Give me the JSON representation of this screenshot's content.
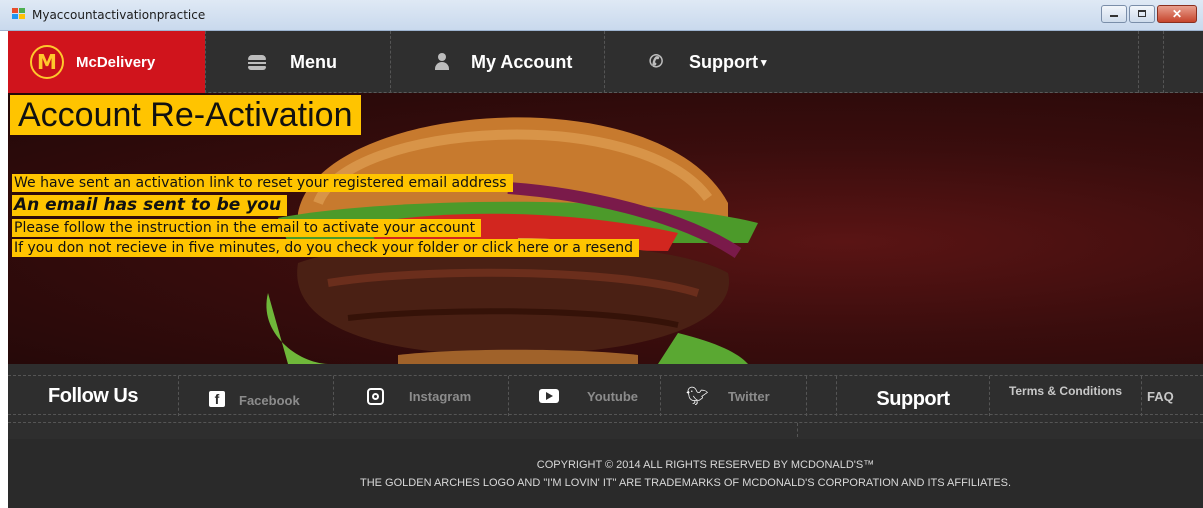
{
  "window": {
    "title": "Myaccountactivationpractice"
  },
  "nav": {
    "brand": "McDelivery",
    "logo_letter": "M",
    "items": [
      {
        "label": "Menu",
        "icon": "burger-icon"
      },
      {
        "label": "My Account",
        "icon": "user-icon"
      },
      {
        "label": "Support",
        "icon": "phone-icon"
      }
    ]
  },
  "hero": {
    "title": "Account Re-Activation",
    "lines": [
      "We have sent an activation link to reset your registered email address",
      "An email has sent to be you",
      "Please follow the instruction in the email to activate your account",
      "If you don not recieve in five minutes, do you check your folder or click here or a resend"
    ]
  },
  "follow": {
    "heading": "Follow Us",
    "social": [
      {
        "label": "Facebook",
        "icon": "facebook-icon"
      },
      {
        "label": "Instagram",
        "icon": "instagram-icon"
      },
      {
        "label": "Youtube",
        "icon": "youtube-icon"
      },
      {
        "label": "Twitter",
        "icon": "twitter-icon"
      }
    ],
    "support_heading": "Support",
    "terms": "Terms & Conditions",
    "faq": "FAQ"
  },
  "footer": {
    "copyright": "COPYRIGHT © 2014 ALL RIGHTS RESERVED BY MCDONALD'S™",
    "trademark": "THE GOLDEN ARCHES LOGO AND \"I'M LOVIN' IT\" ARE TRADEMARKS OF MCDONALD'S CORPORATION AND ITS AFFILIATES."
  },
  "colors": {
    "brand_red": "#d0141c",
    "highlight_yellow": "#ffc400",
    "nav_bg": "#2f2f2f"
  }
}
